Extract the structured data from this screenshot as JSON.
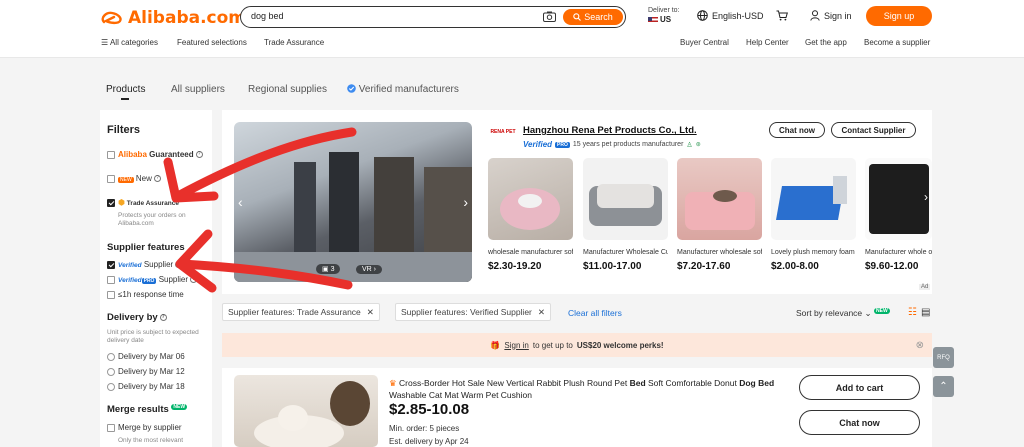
{
  "header": {
    "logo_text": "Alibaba.com",
    "search_value": "dog bed",
    "search_button": "Search",
    "deliver_label": "Deliver to:",
    "deliver_country": "US",
    "language": "English-USD",
    "signin": "Sign in",
    "signup": "Sign up"
  },
  "nav": {
    "all_categories": "All categories",
    "featured": "Featured selections",
    "trade_assurance": "Trade Assurance",
    "buyer_central": "Buyer Central",
    "help_center": "Help Center",
    "get_app": "Get the app",
    "become_supplier": "Become a supplier"
  },
  "tabs": [
    "Products",
    "All suppliers",
    "Regional supplies",
    "Verified manufacturers"
  ],
  "sidebar": {
    "title": "Filters",
    "guaranteed_prefix": "Alibaba",
    "guaranteed_suffix": "Guaranteed",
    "new_tag": "NEW",
    "new_label": "New",
    "trade_assurance": "Trade Assurance",
    "trade_assurance_note": "Protects your orders on Alibaba.com",
    "supplier_features": "Supplier features",
    "verified_supplier": "Supplier",
    "verified_pro_supplier": "Supplier",
    "verified_logo": "Verified",
    "pro_tag": "PRO",
    "response_time": "≤1h response time",
    "delivery_by": "Delivery by",
    "delivery_note": "Unit price is subject to expected delivery date",
    "delivery_options": [
      "Delivery by Mar 06",
      "Delivery by Mar 12",
      "Delivery by Mar 18"
    ],
    "merge_results": "Merge results",
    "merge_new_tag": "NEW",
    "merge_by_supplier": "Merge by supplier",
    "merge_note": "Only the most relevant"
  },
  "hero": {
    "photo_count": "3",
    "vr_label": "VR"
  },
  "supplier": {
    "logo_text": "RENA PET",
    "name": "Hangzhou Rena Pet Products Co., Ltd.",
    "verified_text": "Verified",
    "pro_tag": "PRO",
    "years_text": "15 years pet products manufacturer",
    "chat_now": "Chat now",
    "contact": "Contact Supplier",
    "ad_tag": "Ad",
    "products": [
      {
        "name": "wholesale manufacturer soft luxury plush pink...",
        "price": "$2.30-19.20"
      },
      {
        "name": "Manufacturer Wholesale Custom logo Luxury...",
        "price": "$11.00-17.00"
      },
      {
        "name": "Manufacturer wholesale soft warm plush grey...",
        "price": "$7.20-17.60"
      },
      {
        "name": "Lovely plush memory foam sponge...",
        "price": "$2.00-8.00"
      },
      {
        "name": "Manufacturer whole oxford waterproof...",
        "price": "$9.60-12.00"
      }
    ]
  },
  "active_filters": [
    "Supplier features: Trade Assurance",
    "Supplier features: Verified Supplier"
  ],
  "clear_all": "Clear all filters",
  "sort": "Sort by relevance",
  "sort_new_tag": "NEW",
  "promo": {
    "signin_link": "Sign in",
    "text_middle": "to get up to",
    "amount": "US$20 welcome perks!"
  },
  "listing": {
    "title_prefix": "Cross-Border Hot Sale New Vertical Rabbit Plush Round Pet",
    "title_bold1": "Bed",
    "title_mid": "Soft Comfortable Donut",
    "title_bold2": "Dog Bed",
    "title_rest": "Washable Cat Mat Warm Pet Cushion",
    "price": "$2.85-10.08",
    "min_order": "Min. order: 5 pieces",
    "est_delivery": "Est. delivery by Apr 24",
    "add_to_cart": "Add to cart",
    "chat_now": "Chat now"
  },
  "floating": {
    "rfq": "RFQ"
  },
  "colors": {
    "brand": "#ff6a00",
    "verified_blue": "#1a6fd6",
    "annotation_red": "#e8302b",
    "promo_bg": "#fde7db"
  }
}
